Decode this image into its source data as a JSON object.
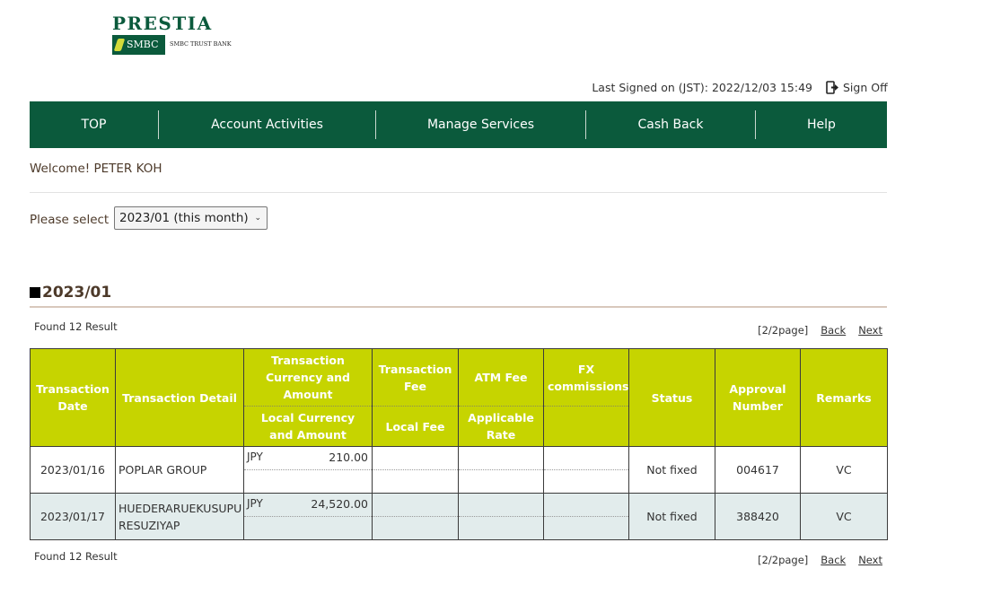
{
  "brand": {
    "name": "PRESTIA",
    "badge": "SMBC",
    "sub": "SMBC TRUST BANK",
    "color": "#0b5a3c"
  },
  "header": {
    "last_signed": "Last Signed on (JST): 2022/12/03 15:49",
    "sign_off": "Sign Off"
  },
  "nav": {
    "items": [
      {
        "label": "TOP"
      },
      {
        "label": "Account Activities"
      },
      {
        "label": "Manage Services"
      },
      {
        "label": "Cash Back"
      },
      {
        "label": "Help"
      }
    ]
  },
  "welcome": "Welcome! PETER KOH",
  "month_select": {
    "label": "Please select",
    "value": "2023/01 (this month)"
  },
  "section": {
    "title": "2023/01"
  },
  "results": {
    "found": "Found 12 Result",
    "page": "[2/2page]",
    "back": "Back",
    "next": "Next"
  },
  "table": {
    "headers": {
      "date": "Transaction Date",
      "detail": "Transaction Detail",
      "currency_top": "Transaction Currency and Amount",
      "currency_bottom": "Local Currency and Amount",
      "fee_top": "Transaction Fee",
      "fee_bottom": "Local Fee",
      "atm_top": "ATM Fee",
      "atm_bottom": "Applicable Rate",
      "fx_top": "FX commissions",
      "status": "Status",
      "approval": "Approval Number",
      "remarks": "Remarks"
    },
    "rows": [
      {
        "date": "2023/01/16",
        "detail": "POPLAR GROUP",
        "currency": "JPY",
        "amount": "210.00",
        "status": "Not fixed",
        "approval": "004617",
        "remarks": "VC"
      },
      {
        "date": "2023/01/17",
        "detail": "HUEDERARUEKUSUPURESUZIYAP",
        "currency": "JPY",
        "amount": "24,520.00",
        "status": "Not fixed",
        "approval": "388420",
        "remarks": "VC"
      }
    ]
  },
  "colors": {
    "header_bg": "#c6d400",
    "alt_row": "#e2ecec"
  }
}
